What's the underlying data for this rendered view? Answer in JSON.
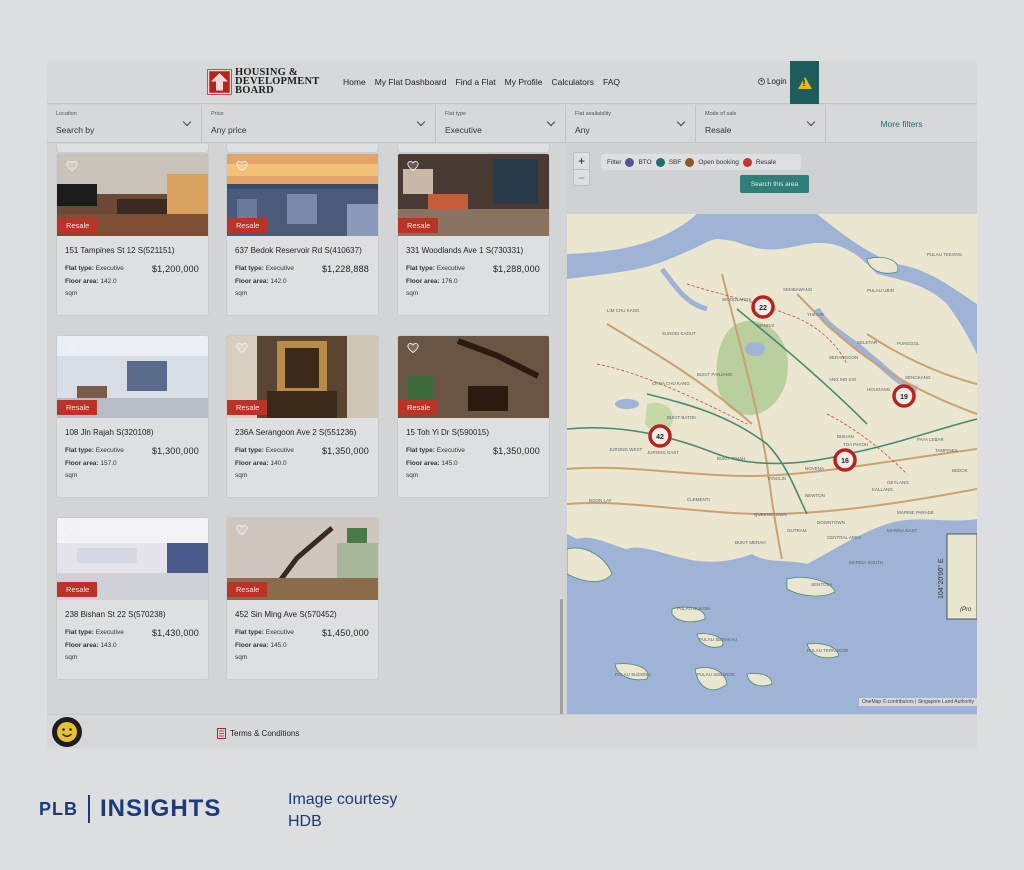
{
  "header": {
    "logo_lines": [
      "HOUSING &",
      "DEVELOPMENT",
      "BOARD"
    ],
    "nav": [
      "Home",
      "My Flat Dashboard",
      "Find a Flat",
      "My Profile",
      "Calculators",
      "FAQ"
    ],
    "login": "Login"
  },
  "filters": [
    {
      "label": "Location",
      "value": "Search by"
    },
    {
      "label": "Price",
      "value": "Any price"
    },
    {
      "label": "Flat type",
      "value": "Executive"
    },
    {
      "label": "Flat availability",
      "value": "Any"
    },
    {
      "label": "Mode of sale",
      "value": "Resale"
    }
  ],
  "more_filters": "More filters",
  "listing_labels": {
    "badge": "Resale",
    "flat_type_label": "Flat type:",
    "floor_area_label": "Floor area:",
    "sqm": "sqm"
  },
  "listings": [
    {
      "address": "151 Tampines St 12 S(521151)",
      "flat_type": "Executive",
      "price": "$1,200,000",
      "floor_area": "142.0"
    },
    {
      "address": "637 Bedok Reservoir Rd S(410637)",
      "flat_type": "Executive",
      "price": "$1,228,888",
      "floor_area": "142.0"
    },
    {
      "address": "331 Woodlands Ave 1 S(730331)",
      "flat_type": "Executive",
      "price": "$1,288,000",
      "floor_area": "176.0"
    },
    {
      "address": "108 Jln Rajah S(320108)",
      "flat_type": "Executive",
      "price": "$1,300,000",
      "floor_area": "157.0"
    },
    {
      "address": "236A Serangoon Ave 2 S(551236)",
      "flat_type": "Executive",
      "price": "$1,350,000",
      "floor_area": "140.0"
    },
    {
      "address": "15 Toh Yi Dr S(590015)",
      "flat_type": "Executive",
      "price": "$1,350,000",
      "floor_area": "145.0"
    },
    {
      "address": "238 Bishan St 22 S(570238)",
      "flat_type": "Executive",
      "price": "$1,430,000",
      "floor_area": "143.0"
    },
    {
      "address": "452 Sin Ming Ave S(570452)",
      "flat_type": "Executive",
      "price": "$1,450,000",
      "floor_area": "145.0"
    }
  ],
  "map": {
    "zoom_in": "+",
    "zoom_out": "−",
    "legend_title": "Filter",
    "legend": [
      {
        "name": "BTO",
        "color": "#5552a0"
      },
      {
        "name": "SBF",
        "color": "#1f6e67"
      },
      {
        "name": "Open booking",
        "color": "#8a5a2b"
      },
      {
        "name": "Resale",
        "color": "#c0392b"
      }
    ],
    "search_button": "Search this area",
    "clusters": [
      "22",
      "19",
      "42",
      "16"
    ],
    "places": [
      "WOODLANDS",
      "MANDAI",
      "SEMBAWANG",
      "YISHUN",
      "SELETAR",
      "PUNGGOL",
      "SENGKANG",
      "HOUGANG",
      "SERANGOON",
      "ANG MO KIO",
      "BISHAN",
      "TOA PAYOH",
      "BUKIT PANJANG",
      "CHOA CHU KANG",
      "BUKIT BATOK",
      "JURONG WEST",
      "JURONG EAST",
      "BUKIT TIMAH",
      "CLEMENTI",
      "QUEENSTOWN",
      "BOON LAY",
      "NOVENA",
      "TANGLIN",
      "NEWTON",
      "GEYLANG",
      "KALLANG",
      "MARINE PARADE",
      "PAYA LEBAR",
      "TAMPINES",
      "BEDOK",
      "BUKIT MERAH",
      "OUTRAM",
      "DOWNTOWN",
      "MARINA SOUTH",
      "CENTRAL AREA",
      "MARINA EAST",
      "LIM CHU KANG",
      "SUNGEI KADUT",
      "PULAU UBIN",
      "PULAU TEKONG",
      "SENTOSA",
      "PULAU BUKOM",
      "PULAU SEMAKAU",
      "PULAU SUDONG",
      "PULAU SEBAROK",
      "PULAU TERKUKOR"
    ],
    "longitude_label": "104°20'00\" E",
    "corner_label": "(Pro",
    "attribution": "OneMap © contributors | Singapore Land Authority"
  },
  "footer": {
    "terms": "Terms & Conditions"
  },
  "brand": {
    "plb": "PLB",
    "insights": "INSIGHTS",
    "courtesy_line1": "Image courtesy",
    "courtesy_line2": "HDB"
  }
}
